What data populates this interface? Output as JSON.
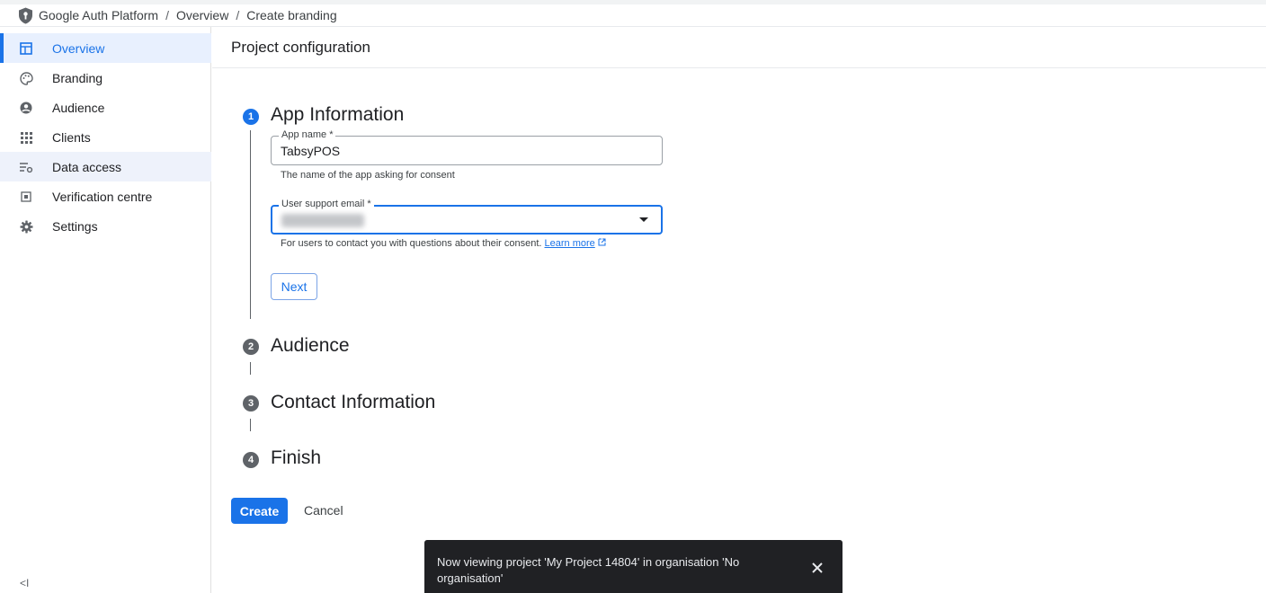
{
  "breadcrumb": {
    "items": [
      "Google Auth Platform",
      "Overview",
      "Create branding"
    ],
    "separator": "/"
  },
  "sidebar": {
    "items": [
      {
        "label": "Overview",
        "icon": "dashboard-icon",
        "state": "selected"
      },
      {
        "label": "Branding",
        "icon": "palette-icon",
        "state": "hover"
      },
      {
        "label": "Audience",
        "icon": "account-circle-icon",
        "state": "normal"
      },
      {
        "label": "Clients",
        "icon": "apps-grid-icon",
        "state": "normal"
      },
      {
        "label": "Data access",
        "icon": "data-access-icon",
        "state": "highlighted"
      },
      {
        "label": "Verification centre",
        "icon": "verification-icon",
        "state": "normal"
      },
      {
        "label": "Settings",
        "icon": "gear-icon",
        "state": "normal"
      }
    ],
    "collapse_glyph": "<I"
  },
  "main": {
    "title": "Project configuration",
    "steps": [
      {
        "number": "1",
        "title": "App Information",
        "active": true
      },
      {
        "number": "2",
        "title": "Audience",
        "active": false
      },
      {
        "number": "3",
        "title": "Contact Information",
        "active": false
      },
      {
        "number": "4",
        "title": "Finish",
        "active": false
      }
    ],
    "app_name": {
      "label": "App name *",
      "value": "TabsyPOS",
      "helper": "The name of the app asking for consent"
    },
    "support_email": {
      "label": "User support email *",
      "value": "",
      "helper": "For users to contact you with questions about their consent.",
      "learn_more": "Learn more"
    },
    "next_label": "Next",
    "create_label": "Create",
    "cancel_label": "Cancel"
  },
  "snackbar": {
    "message": "Now viewing project 'My Project 14804' in organisation 'No organisation'"
  },
  "colors": {
    "accent": "#1a73e8",
    "selected_bg": "#e8f0fe",
    "snackbar_bg": "#202124"
  }
}
